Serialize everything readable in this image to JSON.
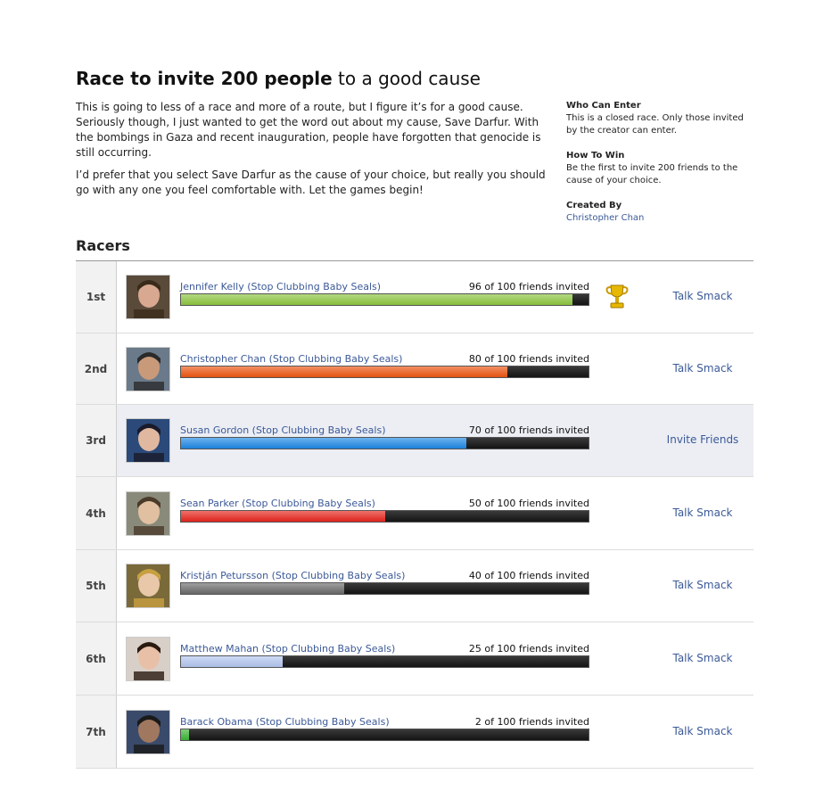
{
  "race": {
    "title_bold": "Race to invite 200 people",
    "title_rest": " to a good cause",
    "description": [
      "This is going to less of a race and more of a route, but I figure it’s for a good cause. Seriously though, I just wanted to get the word out about my cause, Save Darfur. With the bombings in Gaza and recent inauguration, people have forgotten that genocide is still occurring.",
      "I’d prefer that you select Save Darfur as the cause of your choice, but really you should go with any one you feel comfortable with. Let the games begin!"
    ],
    "info": {
      "who_can_enter_heading": "Who Can Enter",
      "who_can_enter_text": "This is a closed race. Only those invited by the creator can enter.",
      "how_to_win_heading": "How To Win",
      "how_to_win_text": "Be the first to invite 200 friends to the cause of your choice.",
      "created_by_heading": "Created By",
      "creator_name": "Christopher Chan"
    }
  },
  "racers_heading": "Racers",
  "racers": [
    {
      "rank": "1st",
      "name": "Jennifer Kelly (Stop Clubbing Baby Seals)",
      "count": "96 of 100 friends invited",
      "progress": 0.96,
      "color": "#8cc63f",
      "action": "Talk Smack",
      "trophy": "trophy-icon",
      "highlight": false
    },
    {
      "rank": "2nd",
      "name": "Christopher Chan (Stop Clubbing Baby Seals)",
      "count": "80 of 100 friends invited",
      "progress": 0.8,
      "color": "#ee5510",
      "action": "Talk Smack",
      "trophy": null,
      "highlight": false
    },
    {
      "rank": "3rd",
      "name": "Susan Gordon (Stop Clubbing Baby Seals)",
      "count": "70 of 100 friends invited",
      "progress": 0.7,
      "color": "#1e88e5",
      "action": "Invite Friends",
      "trophy": null,
      "highlight": true
    },
    {
      "rank": "4th",
      "name": "Sean Parker (Stop Clubbing Baby Seals)",
      "count": "50 of 100 friends invited",
      "progress": 0.5,
      "color": "#e8251d",
      "action": "Talk Smack",
      "trophy": null,
      "highlight": false
    },
    {
      "rank": "5th",
      "name": "Kristján Petursson (Stop Clubbing Baby Seals)",
      "count": "40 of 100 friends invited",
      "progress": 0.4,
      "color": "#6b6b6b",
      "action": "Talk Smack",
      "trophy": null,
      "highlight": false
    },
    {
      "rank": "6th",
      "name": "Matthew Mahan (Stop Clubbing Baby Seals)",
      "count": "25 of 100 friends invited",
      "progress": 0.25,
      "color": "#b3c6f0",
      "action": "Talk Smack",
      "trophy": null,
      "highlight": false
    },
    {
      "rank": "7th",
      "name": "Barack Obama (Stop Clubbing Baby Seals)",
      "count": "2 of 100 friends invited",
      "progress": 0.02,
      "color": "#3cb535",
      "action": "Talk Smack",
      "trophy": null,
      "highlight": false
    }
  ]
}
